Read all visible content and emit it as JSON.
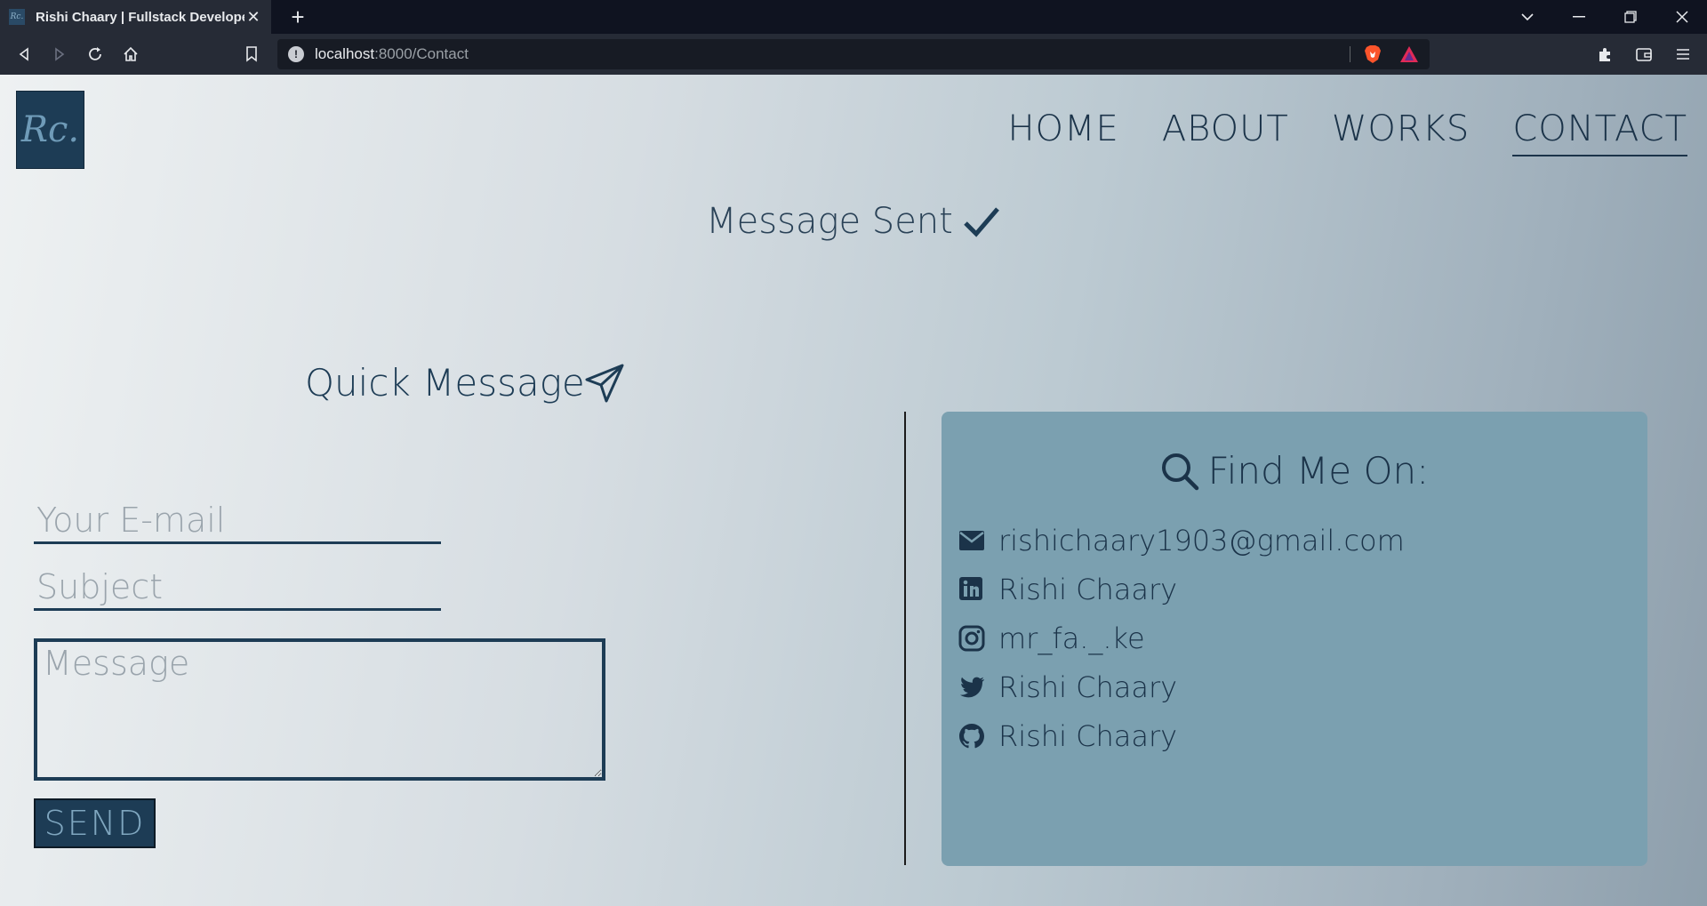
{
  "browser": {
    "tab_title": "Rishi Chaary | Fullstack Developer",
    "tab_favicon_text": "Rc.",
    "url_host": "localhost",
    "url_path": ":8000/Contact"
  },
  "site": {
    "logo_text": "Rc.",
    "nav": [
      {
        "label": "HOME"
      },
      {
        "label": "ABOUT"
      },
      {
        "label": "WORKS"
      },
      {
        "label": "CONTACT",
        "active": true
      }
    ]
  },
  "status": {
    "text": "Message Sent"
  },
  "quick_message": {
    "title": "Quick Message",
    "email_placeholder": "Your E-mail",
    "subject_placeholder": "Subject",
    "message_placeholder": "Message",
    "send_label": "SEND"
  },
  "find_me": {
    "title": "Find Me On:",
    "items": [
      {
        "icon": "envelope-icon",
        "label": "rishichaary1903@gmail.com"
      },
      {
        "icon": "linkedin-icon",
        "label": "Rishi Chaary"
      },
      {
        "icon": "instagram-icon",
        "label": "mr_fa._.ke"
      },
      {
        "icon": "twitter-icon",
        "label": "Rishi Chaary"
      },
      {
        "icon": "github-icon",
        "label": "Rishi Chaary"
      }
    ]
  },
  "colors": {
    "primary": "#1d3c55",
    "card": "#7ba0b0"
  }
}
